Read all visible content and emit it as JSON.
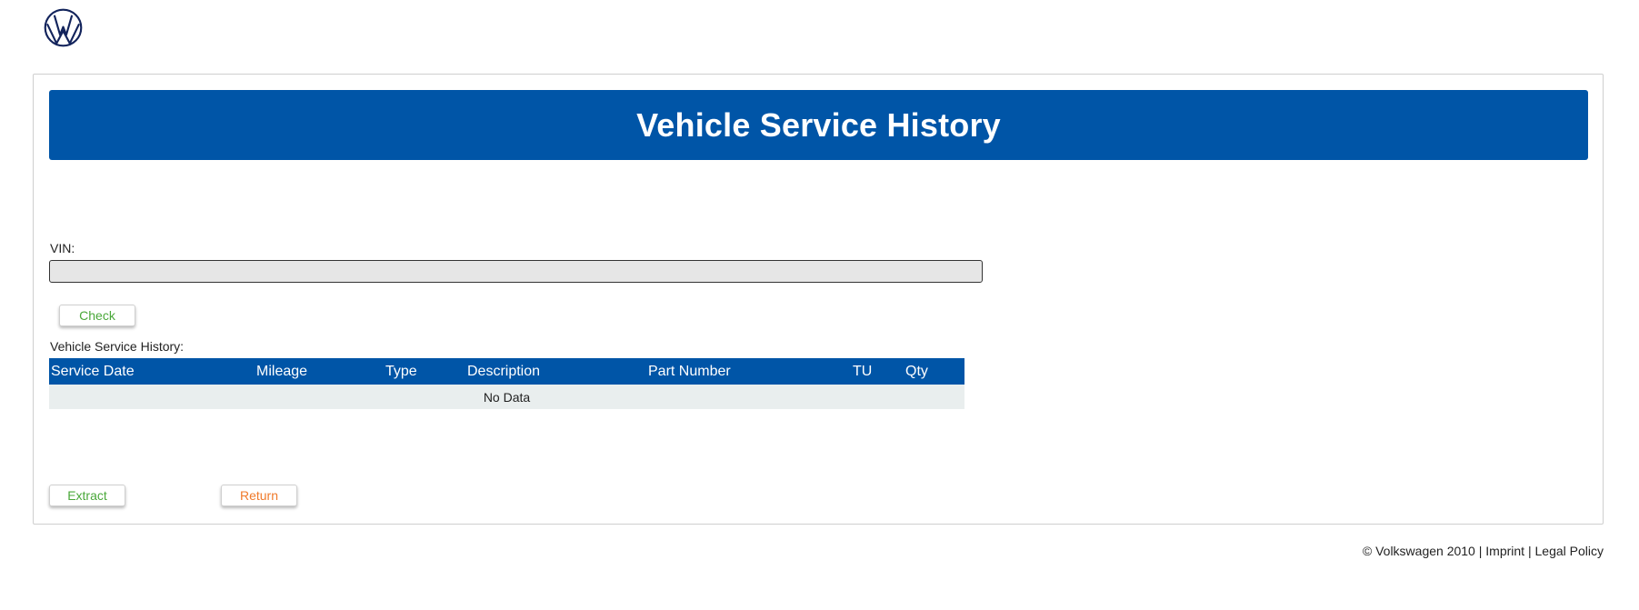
{
  "header": {
    "logo_icon": "vw-logo-icon",
    "brand_color": "#0055a7"
  },
  "banner": {
    "title": "Vehicle Service History"
  },
  "vin": {
    "label": "VIN:",
    "value": "",
    "placeholder": ""
  },
  "actions": {
    "check_label": "Check",
    "extract_label": "Extract",
    "return_label": "Return"
  },
  "history": {
    "label": "Vehicle Service History:",
    "columns": [
      "Service Date",
      "Mileage",
      "Type",
      "Description",
      "Part Number",
      "TU",
      "Qty"
    ],
    "empty_text": "No Data"
  },
  "footer": {
    "copyright": "© Volkswagen 2010",
    "separator": "|",
    "imprint": "Imprint",
    "legal": "Legal Policy"
  },
  "colors": {
    "accent": "#0055a7",
    "success_text": "#4aa83a",
    "warning_text": "#f07a2a",
    "input_bg": "#e6e6e6",
    "empty_row_bg": "#e9eeee"
  }
}
